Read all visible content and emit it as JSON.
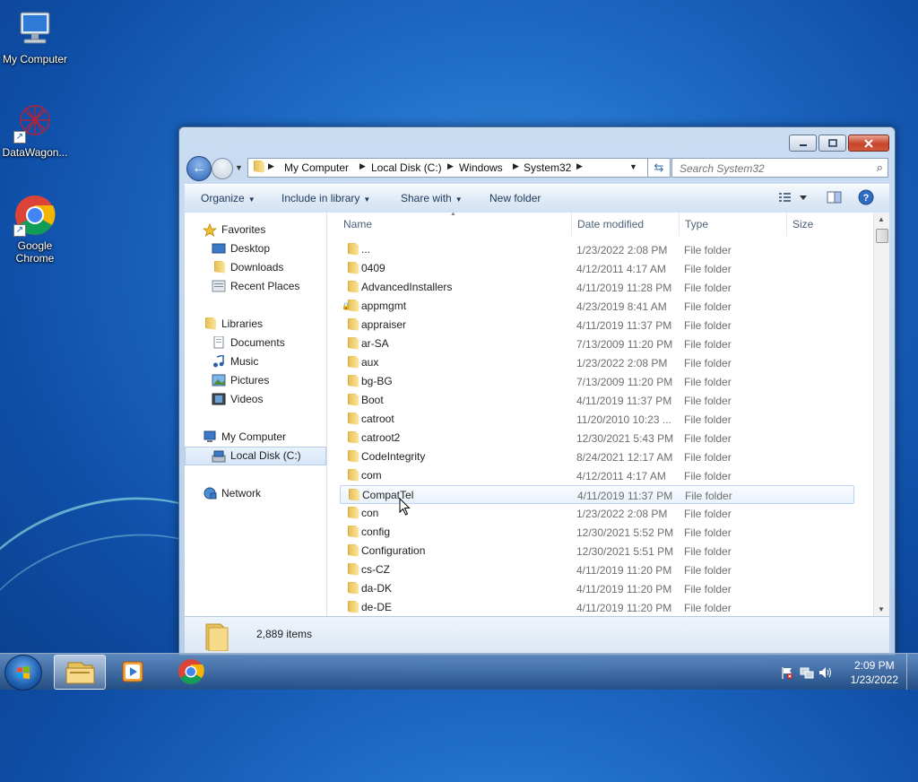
{
  "desktop": {
    "icons": [
      {
        "label": "My Computer"
      },
      {
        "label": "DataWagon..."
      },
      {
        "label": "Google Chrome"
      }
    ]
  },
  "window": {
    "breadcrumbs": [
      "My Computer",
      "Local Disk (C:)",
      "Windows",
      "System32"
    ],
    "search_placeholder": "Search System32",
    "toolbar": {
      "organize": "Organize",
      "include_in_library": "Include in library",
      "share_with": "Share with",
      "new_folder": "New folder"
    },
    "nav": {
      "favorites": "Favorites",
      "desktop": "Desktop",
      "downloads": "Downloads",
      "recent_places": "Recent Places",
      "libraries": "Libraries",
      "documents": "Documents",
      "music": "Music",
      "pictures": "Pictures",
      "videos": "Videos",
      "my_computer": "My Computer",
      "local_disk": "Local Disk (C:)",
      "network": "Network"
    },
    "columns": {
      "name": "Name",
      "date": "Date modified",
      "type": "Type",
      "size": "Size"
    },
    "rows": [
      {
        "name": "...",
        "date": "1/23/2022 2:08 PM",
        "type": "File folder"
      },
      {
        "name": "0409",
        "date": "4/12/2011 4:17 AM",
        "type": "File folder"
      },
      {
        "name": "AdvancedInstallers",
        "date": "4/11/2019 11:28 PM",
        "type": "File folder"
      },
      {
        "name": "appmgmt",
        "date": "4/23/2019 8:41 AM",
        "type": "File folder"
      },
      {
        "name": "appraiser",
        "date": "4/11/2019 11:37 PM",
        "type": "File folder"
      },
      {
        "name": "ar-SA",
        "date": "7/13/2009 11:20 PM",
        "type": "File folder"
      },
      {
        "name": "aux",
        "date": "1/23/2022 2:08 PM",
        "type": "File folder"
      },
      {
        "name": "bg-BG",
        "date": "7/13/2009 11:20 PM",
        "type": "File folder"
      },
      {
        "name": "Boot",
        "date": "4/11/2019 11:37 PM",
        "type": "File folder"
      },
      {
        "name": "catroot",
        "date": "11/20/2010 10:23 ...",
        "type": "File folder"
      },
      {
        "name": "catroot2",
        "date": "12/30/2021 5:43 PM",
        "type": "File folder"
      },
      {
        "name": "CodeIntegrity",
        "date": "8/24/2021 12:17 AM",
        "type": "File folder"
      },
      {
        "name": "com",
        "date": "4/12/2011 4:17 AM",
        "type": "File folder"
      },
      {
        "name": "CompatTel",
        "date": "4/11/2019 11:37 PM",
        "type": "File folder"
      },
      {
        "name": "con",
        "date": "1/23/2022 2:08 PM",
        "type": "File folder"
      },
      {
        "name": "config",
        "date": "12/30/2021 5:52 PM",
        "type": "File folder"
      },
      {
        "name": "Configuration",
        "date": "12/30/2021 5:51 PM",
        "type": "File folder"
      },
      {
        "name": "cs-CZ",
        "date": "4/11/2019 11:20 PM",
        "type": "File folder"
      },
      {
        "name": "da-DK",
        "date": "4/11/2019 11:20 PM",
        "type": "File folder"
      },
      {
        "name": "de-DE",
        "date": "4/11/2019 11:20 PM",
        "type": "File folder"
      }
    ],
    "status": {
      "item_count": "2,889 items"
    }
  },
  "taskbar": {
    "time": "2:09 PM",
    "date": "1/23/2022"
  },
  "colors": {
    "desktop_blue": "#1f6cc7",
    "selection_border": "#b9d2ef",
    "close_red": "#c7442b"
  }
}
